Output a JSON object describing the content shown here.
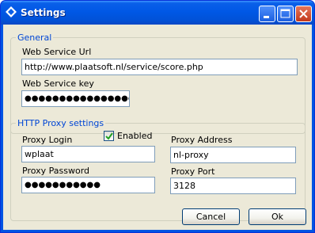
{
  "window": {
    "title": "Settings",
    "icon": "diamond-app-icon",
    "controls": {
      "minimize": "minimize-icon",
      "maximize": "maximize-icon",
      "close": "close-icon"
    }
  },
  "general": {
    "legend": "General",
    "url_label": "Web Service Url",
    "url_value": "http://www.plaatsoft.nl/service/score.php",
    "key_label": "Web Service key",
    "key_value": "●●●●●●●●●●●●●●●●●●"
  },
  "proxy": {
    "legend": "HTTP Proxy settings",
    "enabled_label": "Enabled",
    "enabled_checked": true,
    "login_label": "Proxy Login",
    "login_value": "wplaat",
    "password_label": "Proxy Password",
    "password_value": "●●●●●●●●●●●",
    "address_label": "Proxy Address",
    "address_value": "nl-proxy",
    "port_label": "Proxy Port",
    "port_value": "3128"
  },
  "buttons": {
    "cancel": "Cancel",
    "ok": "Ok"
  }
}
